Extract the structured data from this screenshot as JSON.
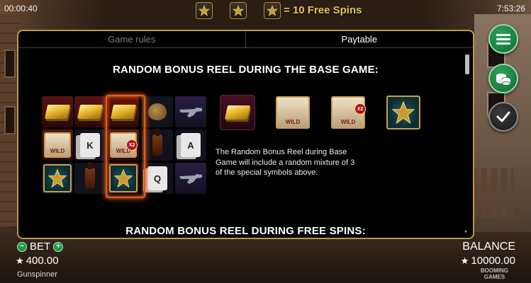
{
  "status": {
    "elapsed_time": "00:00:40",
    "clock": "7:53:26",
    "free_spins_text": "= 10 Free Spins"
  },
  "tabs": [
    {
      "label": "Game rules",
      "active": false
    },
    {
      "label": "Paytable",
      "active": true
    }
  ],
  "paytable": {
    "heading_base": "RANDOM BONUS REEL DURING THE BASE GAME:",
    "description": "The Random Bonus Reel during Base Game will include a random mixture of 3 of the special symbols above.",
    "heading_free_spins": "RANDOM BONUS REEL DURING FREE SPINS:",
    "grid_symbols": [
      [
        "gold-bar",
        "gold-bar",
        "gold-bar",
        "money-bag",
        "revolver"
      ],
      [
        "wild",
        "card-k",
        "wild-x2",
        "bottle",
        "card-a"
      ],
      [
        "scatter",
        "bottle",
        "scatter",
        "card-q",
        "revolver"
      ]
    ],
    "special_symbols": [
      "gold-bar",
      "wild",
      "wild-x2",
      "scatter"
    ]
  },
  "symbol_text": {
    "card_k": "K",
    "card_a": "A",
    "card_q": "Q",
    "x2": "X2"
  },
  "side_buttons": [
    {
      "name": "menu-icon"
    },
    {
      "name": "coins-icon"
    },
    {
      "name": "checkmark-icon"
    }
  ],
  "bet": {
    "label": "BET",
    "value": "400.00",
    "decrease": "−",
    "increase": "+"
  },
  "balance": {
    "label": "BALANCE",
    "value": "10000.00"
  },
  "game_name": "Gunspinner",
  "brand": {
    "line1": "BOOMING",
    "line2": "GAMES"
  },
  "colors": {
    "accent_gold": "#e9c45a",
    "panel_border": "#b99a4c",
    "button_green": "#1b9a43",
    "bonus_glow": "#e65a16"
  }
}
